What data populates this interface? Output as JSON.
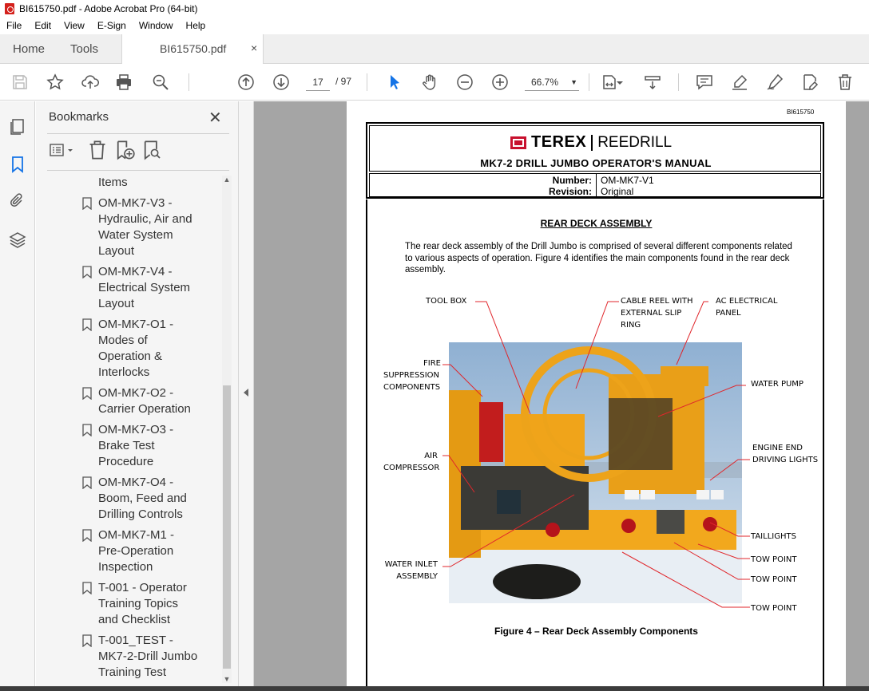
{
  "window": {
    "title": "BI615750.pdf - Adobe Acrobat Pro (64-bit)"
  },
  "menu": [
    "File",
    "Edit",
    "View",
    "E-Sign",
    "Window",
    "Help"
  ],
  "tabs": {
    "home": "Home",
    "tools": "Tools",
    "document": "BI615750.pdf",
    "close_glyph": "×"
  },
  "toolbar": {
    "current_page": "17",
    "page_total": "/ 97",
    "zoom": "66.7%",
    "icons": [
      "save-icon",
      "star-icon",
      "upload-icon",
      "print-icon",
      "zoom-search-icon",
      "page-up-icon",
      "page-down-icon",
      "select-cursor-icon",
      "hand-icon",
      "zoom-out-icon",
      "zoom-in-icon",
      "fit-page-icon",
      "scroll-mode-icon",
      "comment-icon",
      "highlight-icon",
      "sign-icon",
      "edit-pdf-icon",
      "delete-icon"
    ]
  },
  "bookmarks": {
    "title": "Bookmarks",
    "close_glyph": "✕",
    "items": [
      {
        "label": "Items",
        "lines": [
          "Items"
        ],
        "show_flag": false
      },
      {
        "label": "OM-MK7-V3 - Hydraulic, Air and Water System Layout",
        "lines": [
          "OM-MK7-V3 -",
          "Hydraulic, Air and",
          "Water System",
          "Layout"
        ],
        "show_flag": true
      },
      {
        "label": "OM-MK7-V4 - Electrical System Layout",
        "lines": [
          "OM-MK7-V4 -",
          "Electrical System",
          "Layout"
        ],
        "show_flag": true
      },
      {
        "label": "OM-MK7-O1 - Modes of Operation & Interlocks",
        "lines": [
          "OM-MK7-O1 -",
          "Modes of",
          "Operation &",
          "Interlocks"
        ],
        "show_flag": true
      },
      {
        "label": "OM-MK7-O2 - Carrier Operation",
        "lines": [
          "OM-MK7-O2 -",
          "Carrier Operation"
        ],
        "show_flag": true
      },
      {
        "label": "OM-MK7-O3 - Brake Test Procedure",
        "lines": [
          "OM-MK7-O3 -",
          "Brake Test",
          "Procedure"
        ],
        "show_flag": true
      },
      {
        "label": "OM-MK7-O4 - Boom, Feed and Drilling Controls",
        "lines": [
          "OM-MK7-O4 -",
          "Boom, Feed and",
          "Drilling Controls"
        ],
        "show_flag": true
      },
      {
        "label": "OM-MK7-M1 - Pre-Operation Inspection",
        "lines": [
          "OM-MK7-M1 -",
          "Pre-Operation",
          "Inspection"
        ],
        "show_flag": true
      },
      {
        "label": "T-001 - Operator Training Topics and Checklist",
        "lines": [
          "T-001 - Operator",
          "Training Topics",
          "and Checklist"
        ],
        "show_flag": true
      },
      {
        "label": "T-001_TEST - MK7-2-Drill Jumbo Training Test",
        "lines": [
          "T-001_TEST -",
          "MK7-2-Drill Jumbo",
          "Training Test"
        ],
        "show_flag": true
      }
    ]
  },
  "document": {
    "doc_id": "BI615750",
    "logo_left": "TEREX",
    "logo_right": "REEDRILL",
    "manual_title": "MK7-2 DRILL JUMBO OPERATOR'S MANUAL",
    "number_label": "Number:",
    "number_value": "OM-MK7-V1",
    "revision_label": "Revision:",
    "revision_value": "Original",
    "section_title": "REAR DECK ASSEMBLY",
    "paragraph": "The rear deck assembly of the Drill Jumbo is comprised of several different components related to various aspects of operation.  Figure 4 identifies the main components found in the rear deck assembly.",
    "callouts": {
      "tool_box": "TOOL BOX",
      "cable_reel_1": "CABLE REEL WITH",
      "cable_reel_2": "EXTERNAL SLIP",
      "cable_reel_3": "RING",
      "ac_panel_1": "AC ELECTRICAL",
      "ac_panel_2": "PANEL",
      "fire_1": "FIRE",
      "fire_2": "SUPPRESSION",
      "fire_3": "COMPONENTS",
      "water_pump": "WATER PUMP",
      "air_1": "AIR",
      "air_2": "COMPRESSOR",
      "engine_1": "ENGINE END",
      "engine_2": "DRIVING LIGHTS",
      "taillights": "TAILLIGHTS",
      "water_inlet_1": "WATER INLET",
      "water_inlet_2": "ASSEMBLY",
      "tow_1": "TOW POINT",
      "tow_2": "TOW POINT",
      "tow_3": "TOW POINT"
    },
    "caption": "Figure 4 – Rear Deck Assembly Components"
  },
  "colors": {
    "accent_blue": "#1473e6",
    "terex_red": "#c8102e",
    "machine_yellow": "#f2a81d",
    "leader_red": "#e0262b"
  }
}
